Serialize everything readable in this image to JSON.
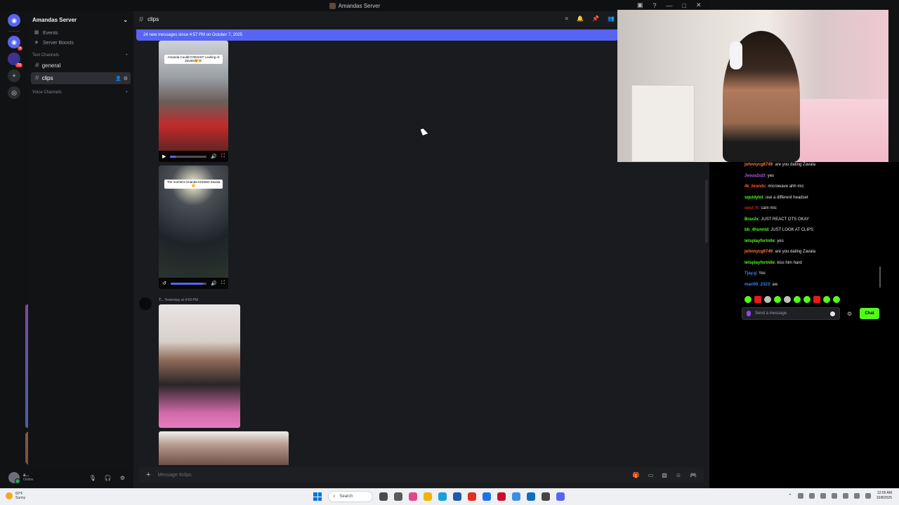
{
  "window": {
    "title": "Amandas Server"
  },
  "server": {
    "name": "Amandas Server",
    "nav": [
      "Events",
      "Server Boosts"
    ],
    "text_category": "Text Channels",
    "voice_category": "Voice Channels",
    "channels": [
      "general",
      "clips"
    ],
    "active_channel": "clips"
  },
  "rail": {
    "badges": [
      "2",
      "4",
      "70"
    ]
  },
  "header": {
    "channel": "clips"
  },
  "banner": {
    "text": "24 new messages since 4:57 PM on October 7, 2025"
  },
  "videos": [
    {
      "caption": "Amanda Couldn't RESIST Looking At Zavala😍🥺",
      "progress": 0.15
    },
    {
      "caption": "The moment Amanda KISSED Zavala 😳",
      "progress": 0.9
    }
  ],
  "message": {
    "author": "7...",
    "time": "Yesterday at 4:59 PM"
  },
  "composer": {
    "placeholder": "Message #clips"
  },
  "user": {
    "name": "a...",
    "status": "Online"
  },
  "chat": {
    "lines": [
      {
        "user": "johnnycg6749",
        "color": "#ff7b3d",
        "text": "are you dating Zavala"
      },
      {
        "user": "Jesus2o2t",
        "color": "#b05cf0",
        "text": "yes"
      },
      {
        "user": "4k_brandc",
        "color": "#ff5c30",
        "text": "microwave ahh mic"
      },
      {
        "user": "squidylol",
        "color": "#53fc18",
        "text": "use a different headset"
      },
      {
        "user": "soul_fr",
        "color": "#d11f3a",
        "text": "cam mic"
      },
      {
        "user": "Brax2x",
        "color": "#53fc18",
        "text": "JUST REACT OTS OKAY"
      },
      {
        "user": "bb_4hunnid",
        "color": "#53fc18",
        "text": "JUST LOOK AT CLIPS"
      },
      {
        "user": "letsplayfortnite",
        "color": "#53fc18",
        "text": "yes"
      },
      {
        "user": "johnnycg6749",
        "color": "#ff7b3d",
        "text": "are you dating Zavala"
      },
      {
        "user": "letsplayfortnite",
        "color": "#53fc18",
        "text": "kiss him hard"
      },
      {
        "user": "Tjay.g",
        "color": "#3b82f6",
        "text": "Yes"
      },
      {
        "user": "mari00_2323",
        "color": "#3b82f6",
        "text": "aw"
      }
    ],
    "input_placeholder": "Send a message",
    "send_label": "Chat",
    "accent": "#53fc18"
  },
  "taskbar": {
    "weather_temp": "60°F",
    "weather_desc": "Sunny",
    "search_label": "Search",
    "time": "12:05 AM",
    "date": "10/8/2025"
  }
}
